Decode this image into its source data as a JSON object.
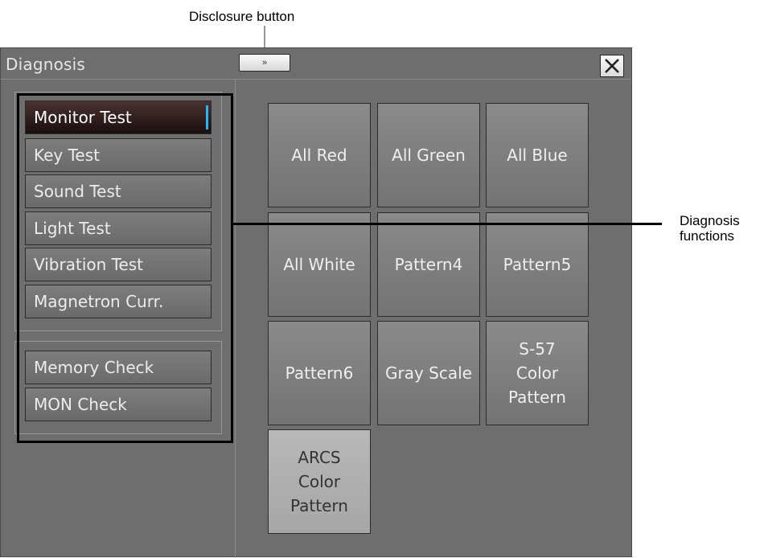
{
  "annotations": {
    "disclosure_label": "Disclosure button",
    "functions_label_line1": "Diagnosis",
    "functions_label_line2": "functions"
  },
  "window": {
    "title": "Diagnosis",
    "disclosure_glyph": "»",
    "close_icon": "close-x-icon"
  },
  "menu": {
    "group1": [
      {
        "label": "Monitor Test",
        "selected": true
      },
      {
        "label": "Key Test"
      },
      {
        "label": "Sound Test"
      },
      {
        "label": "Light Test"
      },
      {
        "label": "Vibration Test"
      },
      {
        "label": "Magnetron Curr."
      }
    ],
    "group2": [
      {
        "label": "Memory Check"
      },
      {
        "label": "MON Check"
      }
    ]
  },
  "tiles": [
    {
      "lines": [
        "All Red"
      ]
    },
    {
      "lines": [
        "All Green"
      ]
    },
    {
      "lines": [
        "All Blue"
      ]
    },
    {
      "lines": [
        "All White"
      ]
    },
    {
      "lines": [
        "Pattern4"
      ]
    },
    {
      "lines": [
        "Pattern5"
      ]
    },
    {
      "lines": [
        "Pattern6"
      ]
    },
    {
      "lines": [
        "Gray Scale"
      ]
    },
    {
      "lines": [
        "S-57",
        "Color",
        "Pattern"
      ]
    },
    {
      "lines": [
        "ARCS",
        "Color",
        "Pattern"
      ]
    }
  ],
  "colors": {
    "panel": "#6e6e6e",
    "selected_bg": "#1a0e0e",
    "selected_accent": "#29b6f6"
  }
}
